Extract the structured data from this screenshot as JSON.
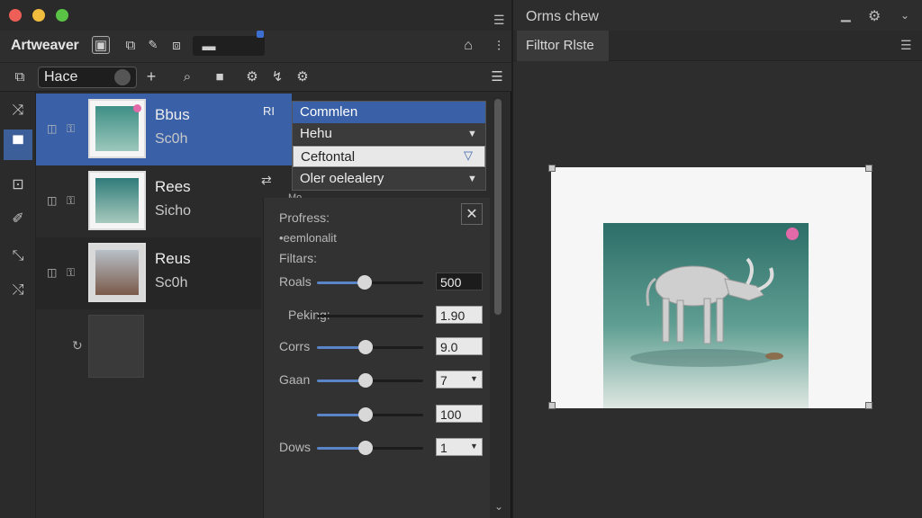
{
  "app": {
    "title": "Artweaver",
    "layer_field_value": "Hace",
    "add_label": "+"
  },
  "layers": [
    {
      "name": "Bbus",
      "sub": "Sc0h",
      "badge": "RI"
    },
    {
      "name": "Rees",
      "sub": "Sicho"
    },
    {
      "name": "Reus",
      "sub": "Sc0h"
    }
  ],
  "dropdown": {
    "items": [
      "Commlen",
      "Hehu",
      "Ceftontal",
      "Oler oelealery"
    ],
    "hint": "Mo"
  },
  "properties": {
    "heading1": "Profress:",
    "heading2": "•eemlonalit",
    "heading3": "Filtars:",
    "rows": [
      {
        "label": "Roals",
        "value": "500",
        "level": 0.45
      },
      {
        "label": "Peking:",
        "value": "1.90",
        "level": 0.0
      },
      {
        "label": "Corrs",
        "value": "9.0",
        "level": 0.46
      },
      {
        "label": "Gaan",
        "value": "7",
        "level": 0.46
      },
      {
        "label": "",
        "value": "100",
        "level": 0.46
      },
      {
        "label": "Dows",
        "value": "1",
        "level": 0.46
      }
    ]
  },
  "right_panel": {
    "title": "Orms chew",
    "tab": "Filttor Rlste"
  },
  "colors": {
    "accent": "#3a61a8",
    "slider": "#5b85c9",
    "badge_pink": "#e36aa8"
  }
}
